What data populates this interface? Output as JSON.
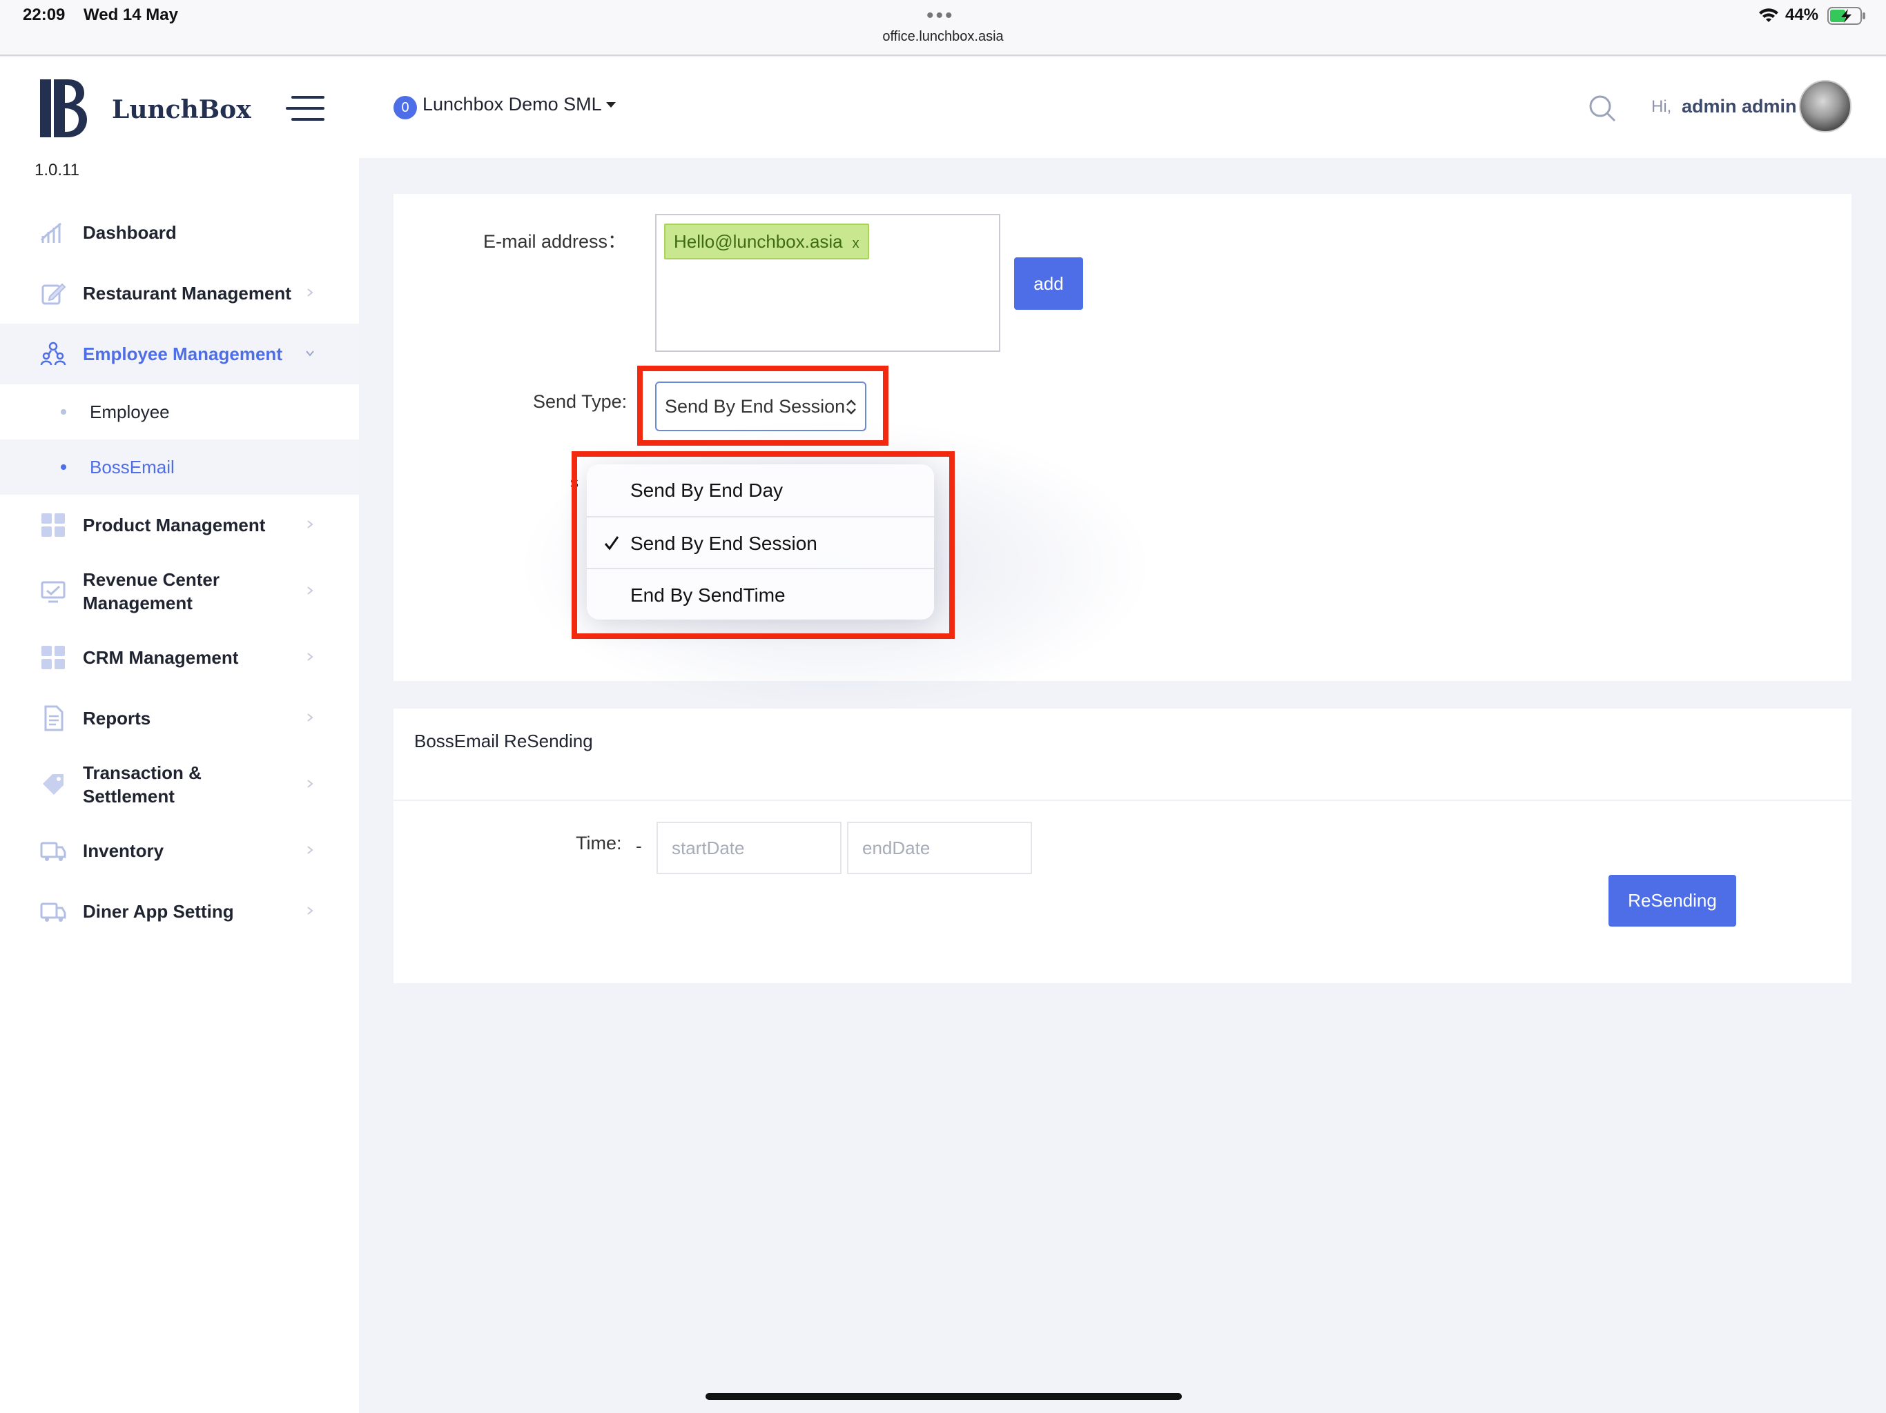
{
  "status_bar": {
    "time": "22:09",
    "date": "Wed 14 May",
    "url": "office.lunchbox.asia",
    "battery_percent": "44%",
    "dots": "•••"
  },
  "sidebar": {
    "brand": "LunchBox",
    "version": "1.0.11",
    "items": [
      {
        "label": "Dashboard",
        "icon": "bar-chart-icon"
      },
      {
        "label": "Restaurant Management",
        "icon": "edit-icon"
      },
      {
        "label": "Employee Management",
        "icon": "people-icon",
        "active": true
      },
      {
        "label": "Product Management",
        "icon": "grid-icon"
      },
      {
        "label": "Revenue Center Management",
        "icon": "monitor-icon"
      },
      {
        "label": "CRM Management",
        "icon": "grid-icon"
      },
      {
        "label": "Reports",
        "icon": "document-icon"
      },
      {
        "label": "Transaction & Settlement",
        "icon": "tag-icon"
      },
      {
        "label": "Inventory",
        "icon": "truck-icon"
      },
      {
        "label": "Diner App Setting",
        "icon": "truck-icon"
      }
    ],
    "subitems": [
      {
        "label": "Employee"
      },
      {
        "label": "BossEmail",
        "active": true
      }
    ]
  },
  "header": {
    "badge_count": "0",
    "shop_name": "Lunchbox Demo SML",
    "greeting": "Hi,",
    "user_name": "admin admin"
  },
  "form": {
    "email_label": "E-mail address：",
    "email_tag": "Hello@lunchbox.asia",
    "tag_remove": "x",
    "add_label": "add",
    "send_type_label": "Send Type:",
    "send_type_value": "Send By End Session",
    "options": [
      {
        "label": "Send By End Day",
        "selected": false
      },
      {
        "label": "Send By End Session",
        "selected": true
      },
      {
        "label": "End By SendTime",
        "selected": false
      }
    ],
    "obscured_fragment": "s"
  },
  "resending": {
    "title": "BossEmail ReSending",
    "time_label": "Time:",
    "separator": "-",
    "start_placeholder": "startDate",
    "end_placeholder": "endDate",
    "button_label": "ReSending"
  },
  "colors": {
    "accent": "#4e6ee8",
    "highlight": "#f2290f",
    "tag_bg": "#c9e78f"
  }
}
